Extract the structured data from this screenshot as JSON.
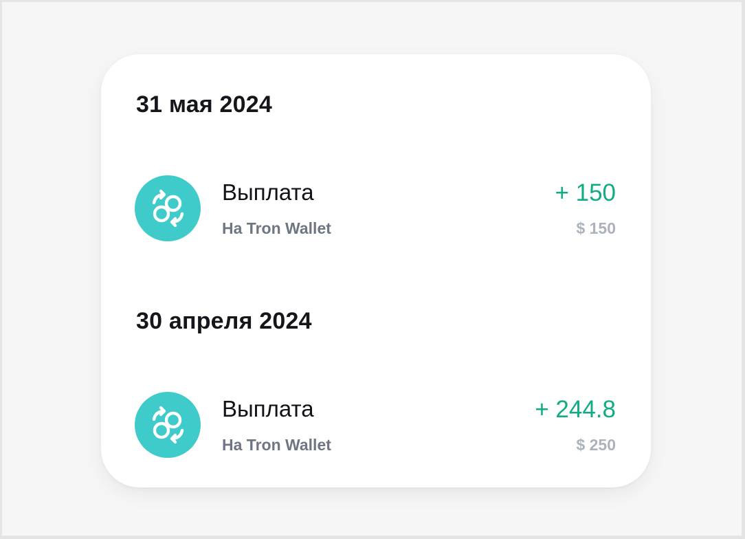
{
  "groups": [
    {
      "date": "31 мая 2024",
      "transaction": {
        "title": "Выплата",
        "subtitle": "На Tron Wallet",
        "amount": "+ 150",
        "usd": "$ 150",
        "icon": "exchange-icon"
      }
    },
    {
      "date": "30 апреля 2024",
      "transaction": {
        "title": "Выплата",
        "subtitle": "На Tron Wallet",
        "amount": "+ 244.8",
        "usd": "$ 250",
        "icon": "exchange-icon"
      }
    }
  ],
  "colors": {
    "icon_bg": "#40cbcb",
    "amount": "#12ab84",
    "subtitle": "#6e7583",
    "usd": "#acb2bc"
  }
}
